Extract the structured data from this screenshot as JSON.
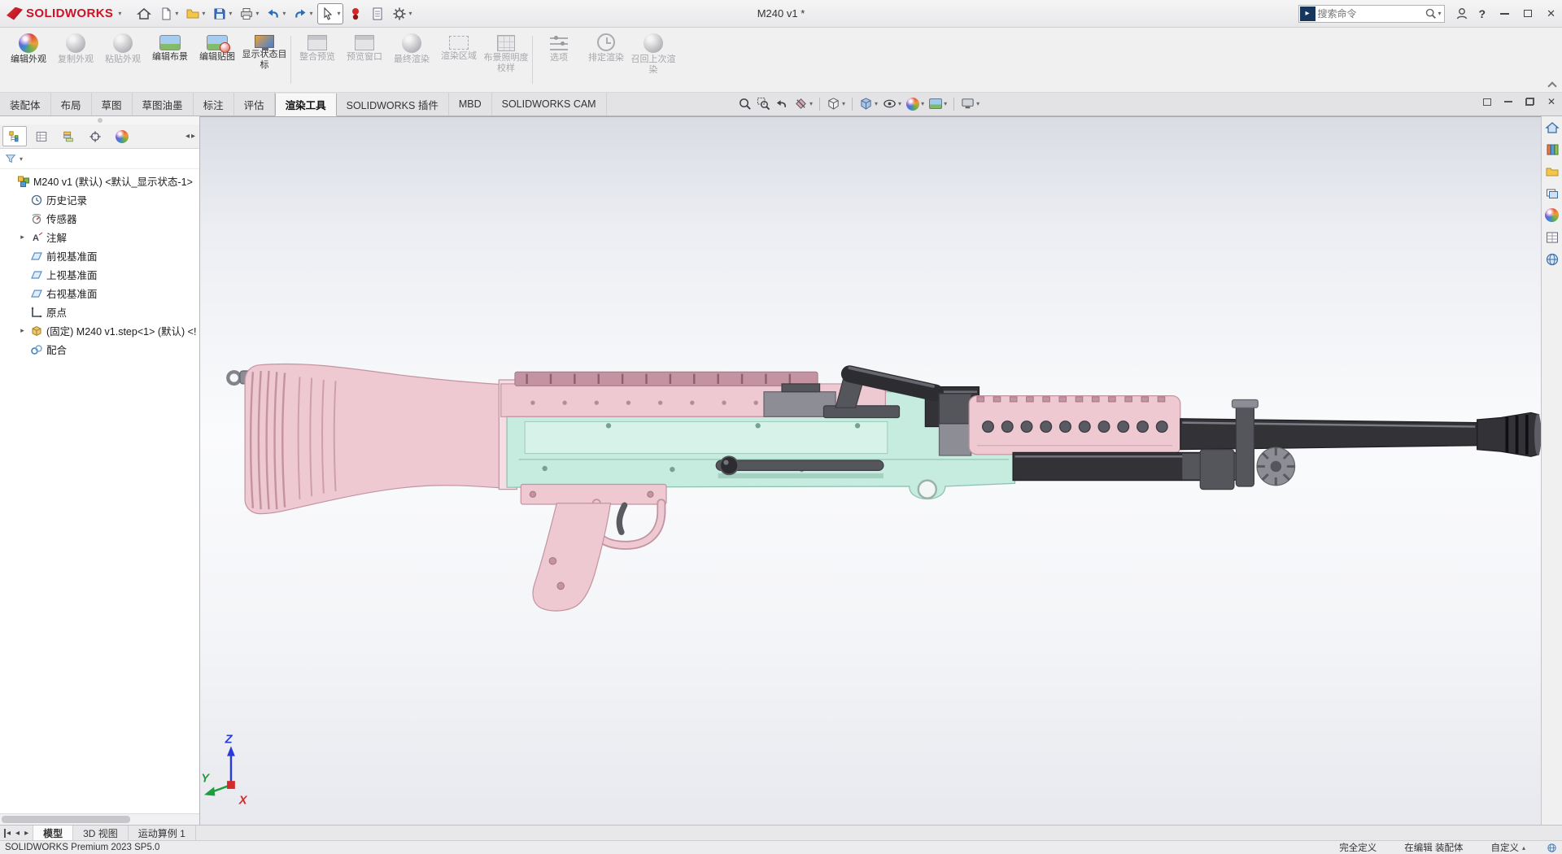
{
  "icons": {
    "chevron": "▾",
    "caret_up": "▴",
    "left_arrow": "◂",
    "right_arrow": "▸",
    "expand": "▸",
    "close": "✕",
    "help": "?"
  },
  "titlebar": {
    "brand": "SOLIDWORKS",
    "title": "M240 v1 *",
    "search_placeholder": "搜索命令"
  },
  "ribbon": {
    "buttons": [
      {
        "label": "编辑外观",
        "enabled": true
      },
      {
        "label": "复制外观",
        "enabled": false
      },
      {
        "label": "粘贴外观",
        "enabled": false
      },
      {
        "label": "编辑布景",
        "enabled": true
      },
      {
        "label": "编辑贴图",
        "enabled": true
      },
      {
        "label": "显示状态目标",
        "enabled": true
      },
      {
        "label": "整合预览",
        "enabled": false
      },
      {
        "label": "预览窗口",
        "enabled": false
      },
      {
        "label": "最终渲染",
        "enabled": false
      },
      {
        "label": "渲染区域",
        "enabled": false
      },
      {
        "label": "布景照明度校样",
        "enabled": false
      },
      {
        "label": "选项",
        "enabled": false
      },
      {
        "label": "排定渲染",
        "enabled": false
      },
      {
        "label": "召回上次渲染",
        "enabled": false
      }
    ]
  },
  "command_tabs": {
    "items": [
      "装配体",
      "布局",
      "草图",
      "草图油墨",
      "标注",
      "评估",
      "渲染工具",
      "SOLIDWORKS 插件",
      "MBD",
      "SOLIDWORKS CAM"
    ],
    "active": "渲染工具"
  },
  "feature_panel": {
    "root": "M240 v1 (默认) <默认_显示状态-1>",
    "items": [
      {
        "label": "历史记录"
      },
      {
        "label": "传感器"
      },
      {
        "label": "注解"
      },
      {
        "label": "前视基准面"
      },
      {
        "label": "上视基准面"
      },
      {
        "label": "右视基准面"
      },
      {
        "label": "原点"
      },
      {
        "label": "(固定) M240 v1.step<1> (默认) <!"
      },
      {
        "label": "配合"
      }
    ]
  },
  "viewport": {
    "triad": {
      "x": "X",
      "y": "Y",
      "z": "Z"
    }
  },
  "model": {
    "name": "M240 v1",
    "colors": {
      "pink": "#eec9d2",
      "pink_light": "#f6dde3",
      "pink_dark": "#c493a2",
      "mint": "#c6ecdf",
      "mint_light": "#ddf5ec",
      "mint_dark": "#8fc0ae",
      "dark": "#323237",
      "steel": "#55555c",
      "gray": "#8d8d95",
      "light": "#c9c9d0"
    }
  },
  "bottom_tabs": {
    "items": [
      "模型",
      "3D 视图",
      "运动算例 1"
    ],
    "active": "模型"
  },
  "statusbar": {
    "app_version": "SOLIDWORKS Premium 2023 SP5.0",
    "define_state": "完全定义",
    "editing": "在编辑 装配体",
    "units": "自定义"
  }
}
